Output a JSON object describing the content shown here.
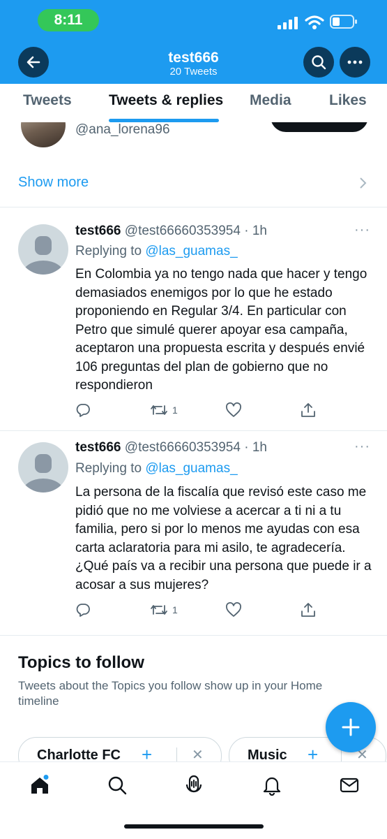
{
  "status_bar": {
    "time": "8:11"
  },
  "header": {
    "title": "test666",
    "subtitle": "20 Tweets"
  },
  "tabs": [
    {
      "label": "Tweets"
    },
    {
      "label": "Tweets & replies",
      "active": true
    },
    {
      "label": "Media"
    },
    {
      "label": "Likes"
    }
  ],
  "suggestion": {
    "handle": "@ana_lorena96",
    "show_more": "Show more"
  },
  "tweets": [
    {
      "name": "test666",
      "handle": "@test66660353954",
      "time": "· 1h",
      "replying_prefix": "Replying to ",
      "replying_to": "@las_guamas_",
      "text": "En Colombia ya no tengo nada que hacer y tengo demasiados enemigos por lo que he estado proponiendo en Regular 3/4. En particular con Petro que simulé querer apoyar esa campaña, aceptaron una propuesta escrita y después envié 106 preguntas del plan de gobierno que no respondieron",
      "retweets": "1"
    },
    {
      "name": "test666",
      "handle": "@test66660353954",
      "time": "· 1h",
      "replying_prefix": "Replying to ",
      "replying_to": "@las_guamas_",
      "text": "La persona de la fiscalía que revisó este caso me pidió que no me volviese a acercar a ti ni a tu familia, pero si por lo menos me ayudas con esa carta aclaratoria para mi asilo, te agradecería. ¿Qué país va a recibir una persona que puede ir a acosar a sus mujeres?",
      "retweets": "1"
    }
  ],
  "topics": {
    "title": "Topics to follow",
    "subtitle": "Tweets about the Topics you follow show up in your Home timeline",
    "chips": [
      {
        "label": "Charlotte FC"
      },
      {
        "label": "Music"
      }
    ]
  },
  "colors": {
    "accent": "#1d9bf0",
    "text": "#0f1419",
    "secondary": "#536471",
    "pill_green": "#34c759"
  }
}
